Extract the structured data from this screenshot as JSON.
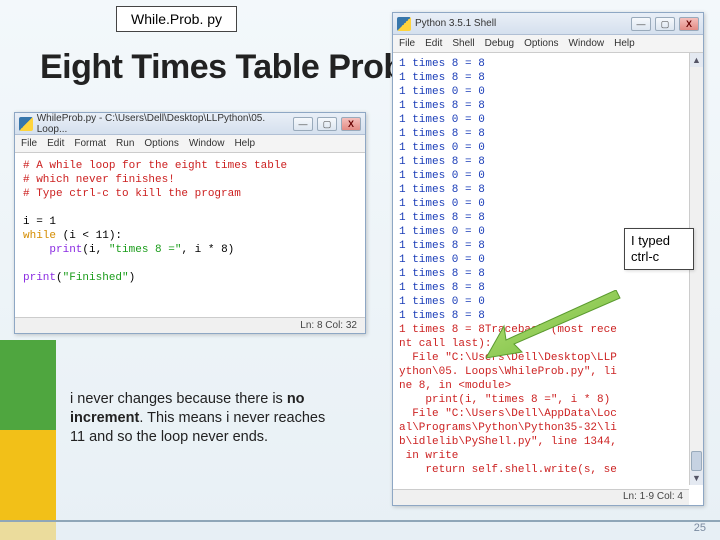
{
  "filename_label": "While.Prob. py",
  "slide_title": "Eight Times Table Problem",
  "editor": {
    "title": "WhileProb.py - C:\\Users\\Dell\\Desktop\\LLPython\\05. Loop...",
    "menu": [
      "File",
      "Edit",
      "Format",
      "Run",
      "Options",
      "Window",
      "Help"
    ],
    "win_min": "—",
    "win_max": "▢",
    "win_close": "X",
    "code": {
      "c1": "# A while loop for the eight times table",
      "c2": "# which never finishes!",
      "c3": "# Type ctrl-c to kill the program",
      "l1a": "i ",
      "l1b": "= ",
      "l1c": "1",
      "l2a": "while",
      "l2b": " (i < ",
      "l2c": "11",
      "l2d": "):",
      "l3a": "    ",
      "l3b": "print",
      "l3c": "(i, ",
      "l3d": "\"times 8 =\"",
      "l3e": ", i * ",
      "l3f": "8",
      "l3g": ")",
      "l4a": "print",
      "l4b": "(",
      "l4c": "\"Finished\"",
      "l4d": ")"
    },
    "status": "Ln: 8  Col: 32"
  },
  "shell": {
    "title": "Python 3.5.1 Shell",
    "menu": [
      "File",
      "Edit",
      "Shell",
      "Debug",
      "Options",
      "Window",
      "Help"
    ],
    "win_min": "—",
    "win_max": "▢",
    "win_close": "X",
    "output_line": "1 times 8 = 8",
    "output_line_alt": "1 times 0 = 0",
    "traceback_head": "1 times 8 = 8Traceback (most rece",
    "tb1": "nt call last):",
    "tb2": "  File \"C:\\Users\\Dell\\Desktop\\LLP",
    "tb3": "ython\\05. Loops\\WhileProb.py\", li",
    "tb4": "ne 8, in <module>",
    "tb5": "    print(i, \"times 8 =\", i * 8)",
    "tb6": "  File \"C:\\Users\\Dell\\AppData\\Loc",
    "tb7": "al\\Programs\\Python\\Python35-32\\li",
    "tb8": "b\\idlelib\\PyShell.py\", line 1344,",
    "tb9": " in write",
    "tb10": "    return self.shell.write(s, se",
    "status": "Ln: 1·9  Col: 4",
    "scroll_up": "▲",
    "scroll_dn": "▼"
  },
  "callout_ctrlc": {
    "l1": "I typed",
    "l2": "ctrl-c"
  },
  "explanation": {
    "p1": "i never changes because there is ",
    "p2": "no increment",
    "p3": ". This means i never reaches 11 and so the loop never ends."
  },
  "page_number": "25"
}
